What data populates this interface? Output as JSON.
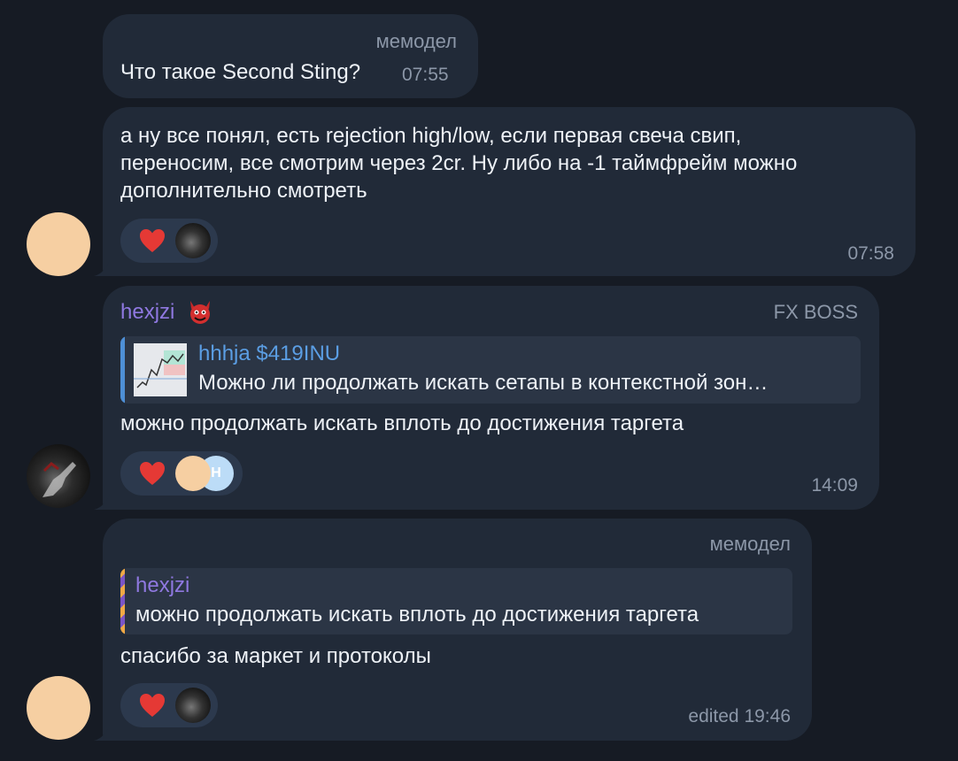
{
  "messages": [
    {
      "sender": "мемодел",
      "text": "Что такое Second Sting?",
      "time": "07:55"
    },
    {
      "text": "а ну все понял, есть rejection high/low, если первая свеча свип,\nпереносим, все смотрим через 2cr. Ну либо на -1 таймфрейм можно\nдополнительно смотреть",
      "time": "07:58",
      "reactions": [
        "heart-reaction",
        "reactor-avatar-photo"
      ]
    },
    {
      "sender": "hexjzi",
      "sender_badge": "devil-emoji",
      "tag": "FX BOSS",
      "reply": {
        "name": "hhhja $419INU",
        "text": "Можно ли продолжать искать сетапы в контекстной зон…"
      },
      "text": "можно продолжать искать вплоть до достижения таргета",
      "time": "14:09",
      "reactions": [
        "heart-reaction",
        "reactor-avatar-peach",
        "reactor-avatar-blue"
      ]
    },
    {
      "sender": "мемодел",
      "reply": {
        "name": "hexjzi",
        "text": "можно продолжать искать вплоть до достижения таргета"
      },
      "text": "спасибо за маркет и протоколы",
      "time": "edited 19:46",
      "reactions": [
        "heart-reaction",
        "reactor-avatar-photo"
      ]
    }
  ],
  "colors": {
    "background": "#161b24",
    "bubble": "#212a38",
    "accent_purple": "#8f78e0",
    "accent_blue": "#5b9ee4",
    "heart": "#e53935"
  }
}
